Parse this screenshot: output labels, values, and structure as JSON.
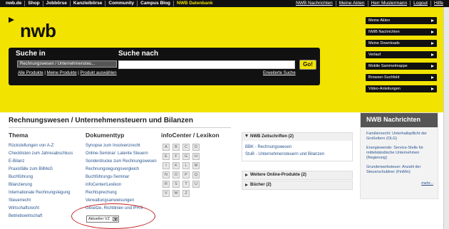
{
  "topnav": {
    "left": [
      "nwb.de",
      "Shop",
      "Jobbörse",
      "Kanzleibörse",
      "Community",
      "Campus Blog",
      "NWB Datenbank"
    ],
    "right": [
      "NWB Nachrichten",
      "Meine Akten",
      "Herr Mustermann",
      "Logout",
      "Hilfe"
    ]
  },
  "logo": "nwb",
  "search": {
    "in_label": "Suche in",
    "for_label": "Suche nach",
    "scope_value": "Rechnungswesen / Unternehmensteu...",
    "query_value": "",
    "go_label": "Go!",
    "links": [
      "Alle Produkte",
      "Meine Produkte",
      "Produkt auswählen"
    ],
    "advanced": "Erweiterte Suche"
  },
  "quickmenu": [
    "Meine Akten",
    "NWB Nachrichten",
    "Meine Downloads",
    "Verlauf",
    "Mobile Sammelmappe",
    "Browser-Suchfeld",
    "Video-Anleitungen"
  ],
  "page_title": "Rechnungswesen / Unternehmensteuern und Bilanzen",
  "thema": {
    "heading": "Thema",
    "items": [
      "Rückstellungen von A-Z",
      "Checklisten zum Jahresabschluss",
      "E-Bilanz",
      "Praxisfälle zum BilMoG",
      "Buchführung",
      "Bilanzierung",
      "Internationale Rechnungslegung",
      "Steuerrecht",
      "Wirtschaftsrecht",
      "Betriebswirtschaft"
    ]
  },
  "dokumenttyp": {
    "heading": "Dokumenttyp",
    "items": [
      "Synopse zum Insolvenzrecht",
      "Online-Seminar: Latente Steuern",
      "Sonderdrucke zum Rechnungswesen",
      "Rechnungslegungsvergleich",
      "Buchführungs-Seminar",
      "infoCenter/Lexikon",
      "Rechtsprechung",
      "Verwaltungsanweisungen",
      "Gesetze, Richtlinien und IFRS"
    ],
    "select_value": "Aktueller VZ"
  },
  "infocenter": {
    "heading": "infoCenter / Lexikon",
    "letters": [
      "A",
      "B",
      "C",
      "D",
      "E",
      "F",
      "G",
      "H",
      "I",
      "K",
      "L",
      "M",
      "N",
      "O",
      "P",
      "Q",
      "R",
      "S",
      "T",
      "U",
      "V",
      "W",
      "Z"
    ]
  },
  "panels": {
    "zeitschriften": {
      "title": "NWB Zeitschriften (2)",
      "items": [
        "BBK - Rechnungswesen",
        "StuB - Unternehmensteuern und Bilanzen"
      ]
    },
    "weitere": {
      "title": "Weitere Online-Produkte (2)"
    },
    "buecher": {
      "title": "Bücher (2)"
    }
  },
  "news": {
    "heading": "NWB Nachrichten",
    "items": [
      "Familienrecht: Unterhaltspflicht der Großeltern (OLG)",
      "Energiewende: Service-Stelle für mittelständische Unternehmen (Regierung)",
      "Grunderwerbsteuer: Anzahl der Steuerschuldner (FinMin)"
    ],
    "more": "mehr..."
  }
}
